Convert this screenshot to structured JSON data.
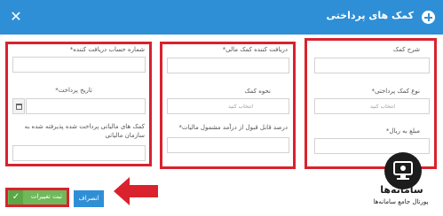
{
  "header": {
    "title": "کمک های پرداختی"
  },
  "right_column": {
    "fields": [
      {
        "label": "شرح کمک",
        "value": ""
      },
      {
        "label": "نوع کمک پرداختی*",
        "placeholder": "انتخاب کنید"
      },
      {
        "label": "مبلغ به ریال*",
        "value": ""
      }
    ]
  },
  "middle_column": {
    "fields": [
      {
        "label": "دریافت کننده کمک مالی*",
        "value": ""
      },
      {
        "label": "نحوه کمک",
        "placeholder": "انتخاب کنید"
      },
      {
        "label": "درصد قابل قبول از درآمد مشمول مالیات*",
        "value": ""
      }
    ]
  },
  "left_column": {
    "fields": [
      {
        "label": "شماره حساب دریافت کننده*",
        "value": ""
      },
      {
        "label": "تاریخ پرداخت*",
        "value": ""
      },
      {
        "label": "کمک های مالیاتی پرداخت شده پذیرفته شده به سازمان مالیاتی",
        "value": ""
      }
    ]
  },
  "buttons": {
    "save": "ثبت تغییرات",
    "cancel": "انصراف"
  },
  "logo": {
    "brand": "سامانه‌ها",
    "slogan": "پورتال جامع سامانه‌ها"
  },
  "colors": {
    "header": "#2f8fd6",
    "highlight": "#d9222e",
    "save": "#6fb95a"
  }
}
